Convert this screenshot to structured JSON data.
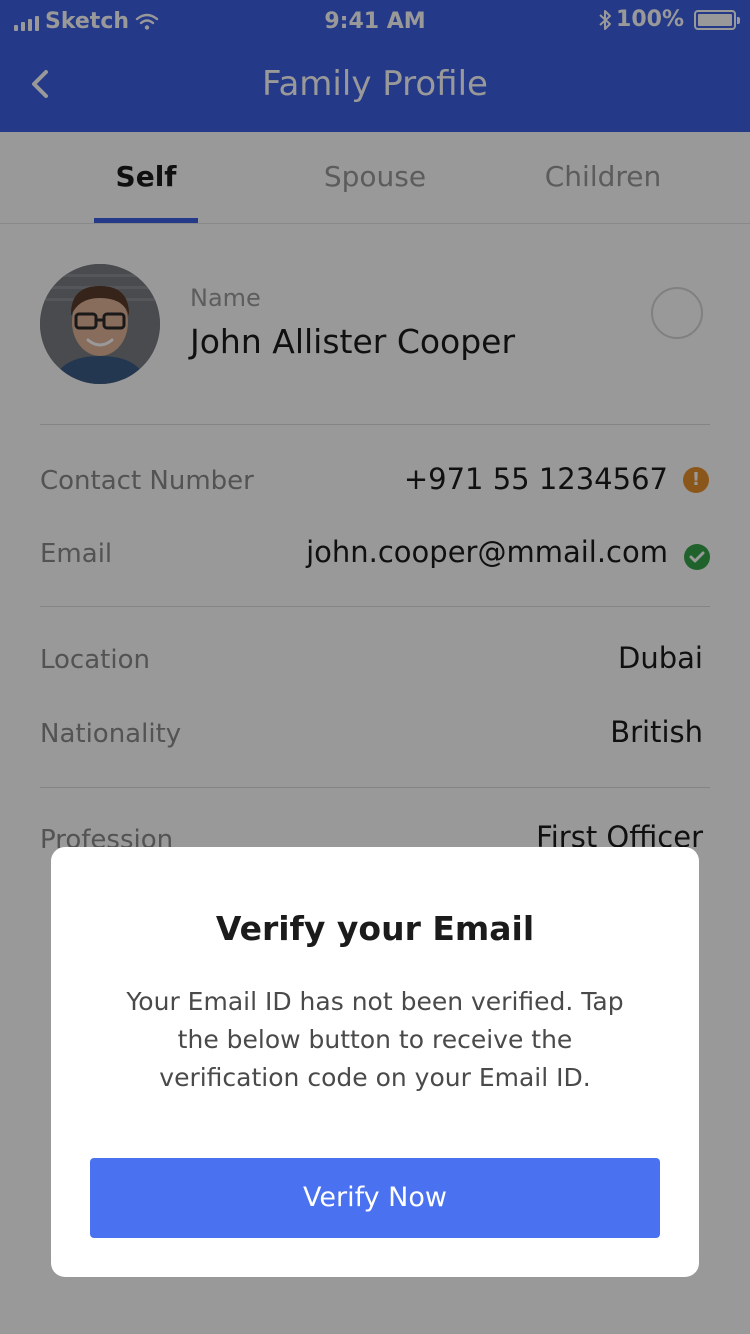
{
  "status_bar": {
    "carrier": "Sketch",
    "time": "9:41 AM",
    "battery": "100%",
    "signal_icon": "signal-bars-icon",
    "wifi_icon": "wifi-icon",
    "bluetooth_icon": "bluetooth-icon",
    "battery_icon": "battery-icon"
  },
  "navbar": {
    "title": "Family Profile",
    "back_icon": "chevron-left-icon"
  },
  "tabs": [
    {
      "label": "Self",
      "active": true
    },
    {
      "label": "Spouse",
      "active": false
    },
    {
      "label": "Children",
      "active": false
    }
  ],
  "profile": {
    "name_label": "Name",
    "name": "John Allister Cooper",
    "avatar": "avatar-photo"
  },
  "details": {
    "contact": {
      "label": "Contact Number",
      "value": "+971 55 1234567",
      "status": "unverified",
      "status_icon": "warning-icon",
      "status_color": "#e8902c"
    },
    "email": {
      "label": "Email",
      "value": "john.cooper@mmail.com",
      "status": "verified",
      "status_icon": "check-icon",
      "status_color": "#34a34a"
    },
    "location": {
      "label": "Location",
      "value": "Dubai"
    },
    "nationality": {
      "label": "Nationality",
      "value": "British"
    },
    "profession": {
      "label": "Profession",
      "value": "First Officer"
    }
  },
  "dialog": {
    "title": "Verify your Email",
    "message": "Your Email ID has not been verified. Tap the below button to receive the verification code on your Email ID.",
    "button_label": "Verify Now"
  },
  "colors": {
    "brand": "#3d5fe3",
    "button": "#4a72f0",
    "overlay": "rgba(0,0,0,0.40)"
  }
}
